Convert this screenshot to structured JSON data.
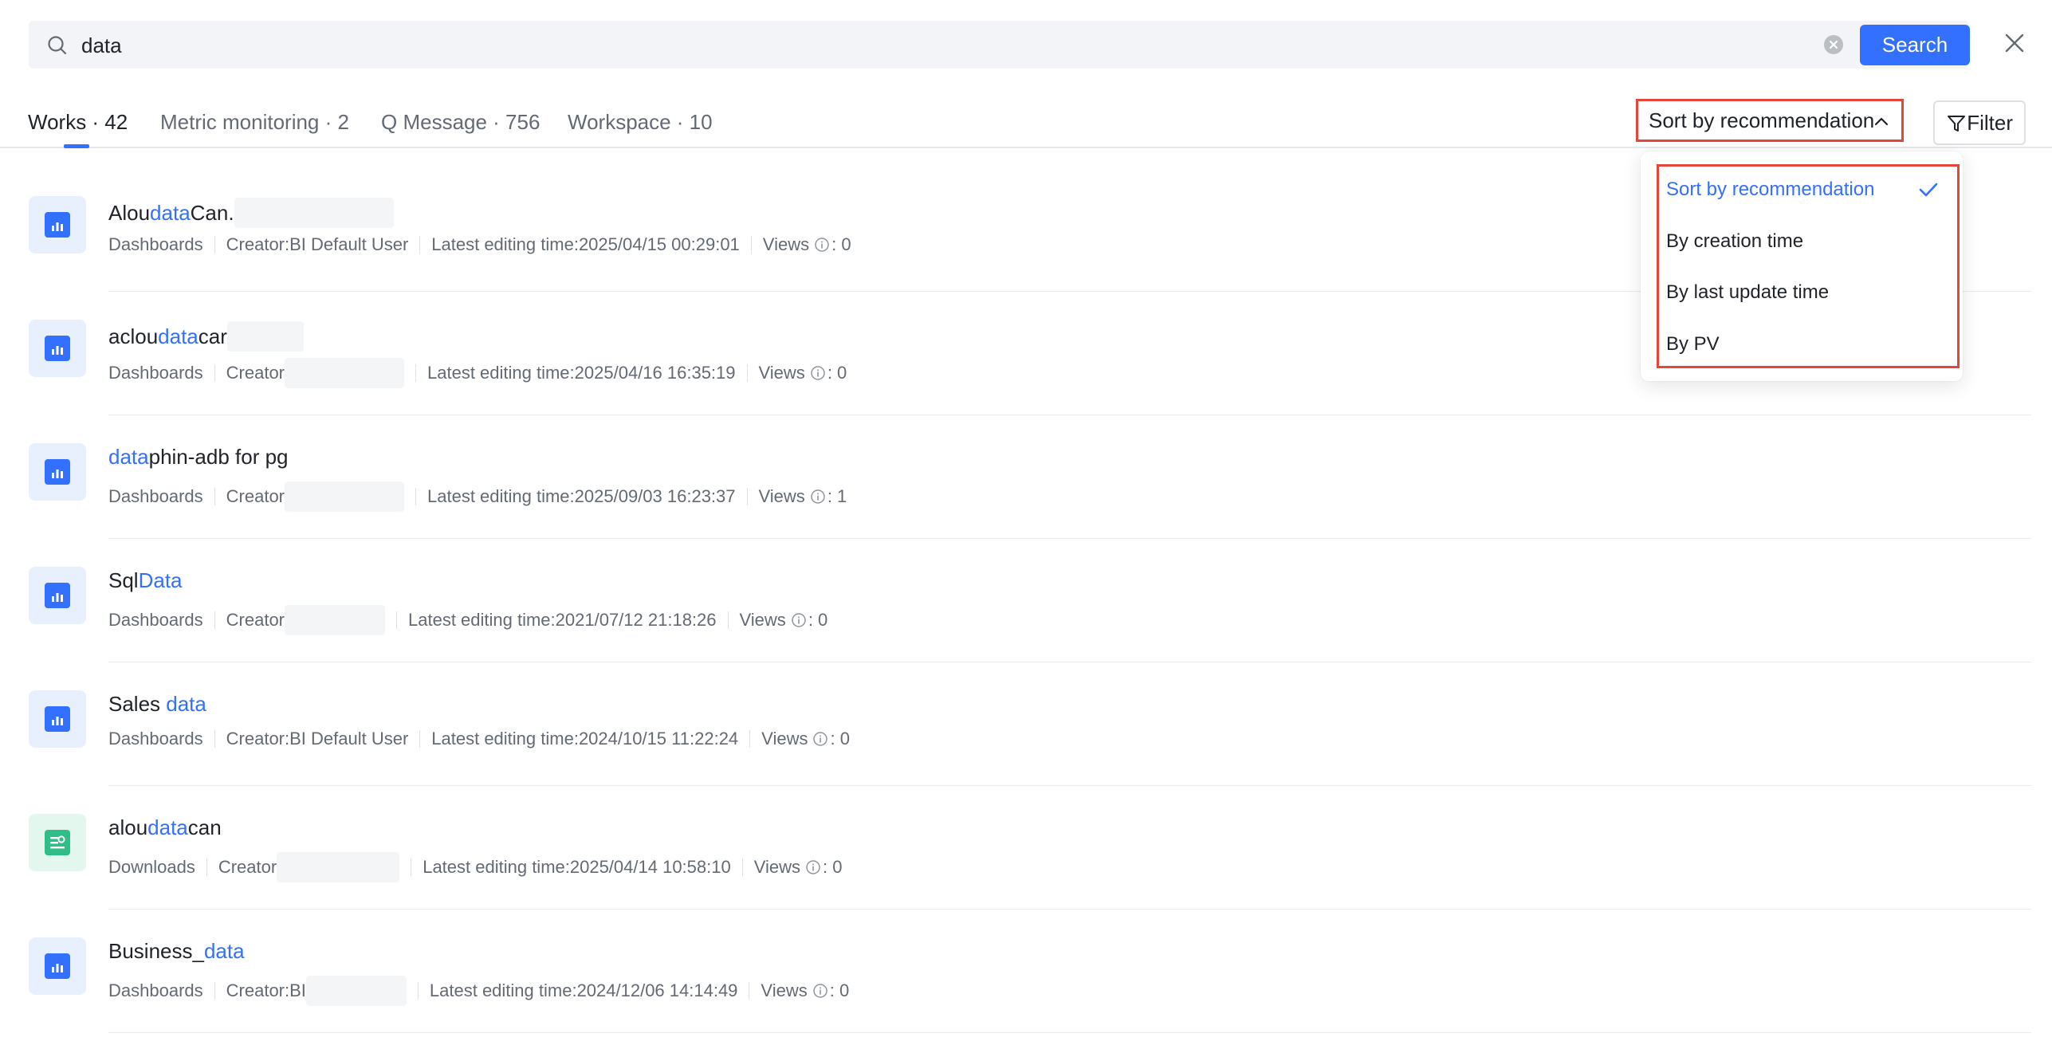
{
  "search": {
    "value": "data",
    "button_label": "Search"
  },
  "tabs": [
    {
      "label": "Works · 42",
      "active": true
    },
    {
      "label": "Metric monitoring · 2",
      "active": false
    },
    {
      "label": "Q Message · 756",
      "active": false
    },
    {
      "label": "Workspace · 10",
      "active": false
    }
  ],
  "sort": {
    "selected_label": "Sort by recommendation",
    "options": [
      {
        "label": "Sort by recommendation",
        "selected": true
      },
      {
        "label": "By creation time",
        "selected": false
      },
      {
        "label": "By last update time",
        "selected": false
      },
      {
        "label": "By PV",
        "selected": false
      }
    ]
  },
  "filter": {
    "label": "Filter"
  },
  "results": [
    {
      "icon": "dashboard-icon",
      "title_pre": "Alou",
      "title_hl": "data",
      "title_post": "Can.",
      "type": "Dashboards",
      "creator": "Creator:BI Default User",
      "edited": "Latest editing time:2025/04/15 00:29:01",
      "views_label": "Views",
      "views": ": 0"
    },
    {
      "icon": "dashboard-icon",
      "title_pre": "aclou",
      "title_hl": "data",
      "title_post": "car",
      "type": "Dashboards",
      "creator": "Creator",
      "edited": "Latest editing time:2025/04/16 16:35:19",
      "views_label": "Views",
      "views": ": 0"
    },
    {
      "icon": "dashboard-icon",
      "title_pre": "",
      "title_hl": "data",
      "title_post": "phin-adb for pg",
      "type": "Dashboards",
      "creator": "Creator",
      "edited": "Latest editing time:2025/09/03 16:23:37",
      "views_label": "Views",
      "views": ": 1"
    },
    {
      "icon": "dashboard-icon",
      "title_pre": "Sql",
      "title_hl": "Data",
      "title_post": "",
      "type": "Dashboards",
      "creator": "Creator",
      "edited": "Latest editing time:2021/07/12 21:18:26",
      "views_label": "Views",
      "views": ": 0"
    },
    {
      "icon": "dashboard-icon",
      "title_pre": "Sales ",
      "title_hl": "data",
      "title_post": "",
      "type": "Dashboards",
      "creator": "Creator:BI Default User",
      "edited": "Latest editing time:2024/10/15 11:22:24",
      "views_label": "Views",
      "views": ": 0"
    },
    {
      "icon": "download-icon",
      "title_pre": "alou",
      "title_hl": "data",
      "title_post": "can",
      "type": "Downloads",
      "creator": "Creator",
      "edited": "Latest editing time:2025/04/14 10:58:10",
      "views_label": "Views",
      "views": ": 0"
    },
    {
      "icon": "dashboard-icon",
      "title_pre": "Business_",
      "title_hl": "data",
      "title_post": "",
      "type": "Dashboards",
      "creator": "Creator:BI",
      "edited": "Latest editing time:2024/12/06 14:14:49",
      "views_label": "Views",
      "views": ": 0"
    }
  ],
  "colors": {
    "accent": "#3370ff",
    "highlight_box": "#e4463c",
    "download_icon": "#2fbe87"
  }
}
